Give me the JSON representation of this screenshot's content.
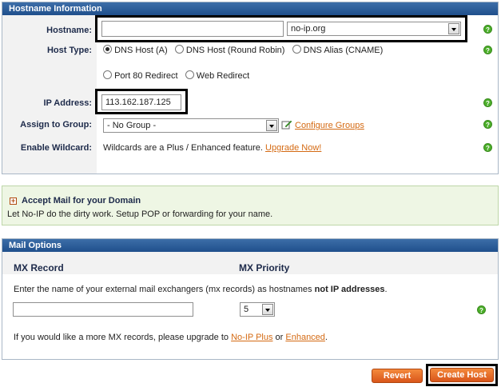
{
  "hostname_panel": {
    "title": "Hostname Information",
    "hostname_label": "Hostname:",
    "hostname_value": "",
    "domain_select": "no-ip.org",
    "host_type_label": "Host Type:",
    "host_types": [
      "DNS Host (A)",
      "DNS Host (Round Robin)",
      "DNS Alias (CNAME)",
      "Port 80 Redirect",
      "Web Redirect"
    ],
    "selected_host_type": "DNS Host (A)",
    "ip_label": "IP Address:",
    "ip_value": "113.162.187.125",
    "group_label": "Assign to Group:",
    "group_select": "- No Group -",
    "configure_groups": "Configure Groups",
    "wildcard_label": "Enable Wildcard:",
    "wildcard_text": "Wildcards are a Plus / Enhanced feature.",
    "upgrade_now": "Upgrade Now!",
    "help_glyph": "?"
  },
  "mail_panel": {
    "title": "Accept Mail for your Domain",
    "description": "Let No-IP do the dirty work. Setup POP or forwarding for your name."
  },
  "mail_options": {
    "title": "Mail Options",
    "mx_record_header": "MX Record",
    "mx_priority_header": "MX Priority",
    "instructions_prefix": "Enter the name of your external mail exchangers (mx records) as hostnames",
    "instructions_bold": "not IP addresses",
    "instructions_suffix": ".",
    "mx_record_value": "",
    "mx_priority_value": "5",
    "upgrade_prefix": "If you would like a more MX records, please upgrade to",
    "no_ip_plus": "No-IP Plus",
    "or_text": "or",
    "enhanced": "Enhanced",
    "upgrade_suffix": "."
  },
  "actions": {
    "revert": "Revert",
    "create_host": "Create Host"
  },
  "colors": {
    "header_blue": "#1f4f8c",
    "link_orange": "#d46a13",
    "button_orange": "#d9561b",
    "help_green": "#4caf2a"
  }
}
